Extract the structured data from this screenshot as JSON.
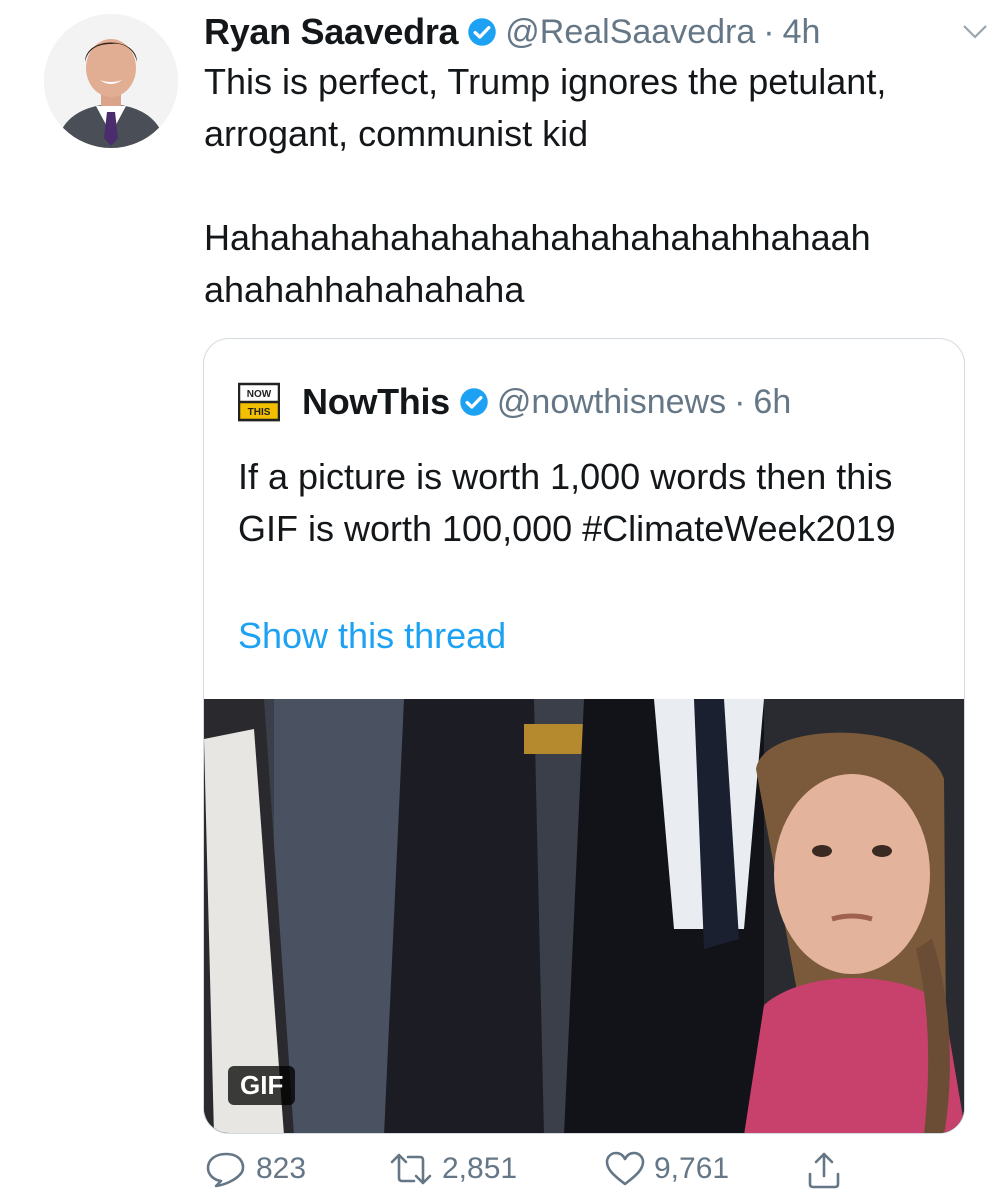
{
  "author": {
    "display_name": "Ryan Saavedra",
    "handle": "@RealSaavedra",
    "separator": "·",
    "time": "4h",
    "avatar_icon": "profile-avatar"
  },
  "tweet": {
    "line1": "This is perfect, Trump ignores the petulant, arrogant, communist kid",
    "line2": "Hahahahahahahahahahahahahahhahaah ahahahhahahahaha"
  },
  "quoted": {
    "display_name": "NowThis",
    "handle": "@nowthisnews",
    "separator": "·",
    "time": "6h",
    "logo_text_top": "NOW",
    "logo_text_bottom": "THIS",
    "text": "If a picture is worth 1,000 words then this GIF is worth 100,000 #ClimateWeek2019",
    "show_thread": "Show this thread",
    "media_badge": "GIF"
  },
  "actions": {
    "replies": "823",
    "retweets": "2,851",
    "likes": "9,761"
  },
  "colors": {
    "text": "#14171a",
    "secondary": "#657786",
    "link": "#1da1f2",
    "verified": "#1da1f2",
    "border": "#d4dbe0"
  }
}
